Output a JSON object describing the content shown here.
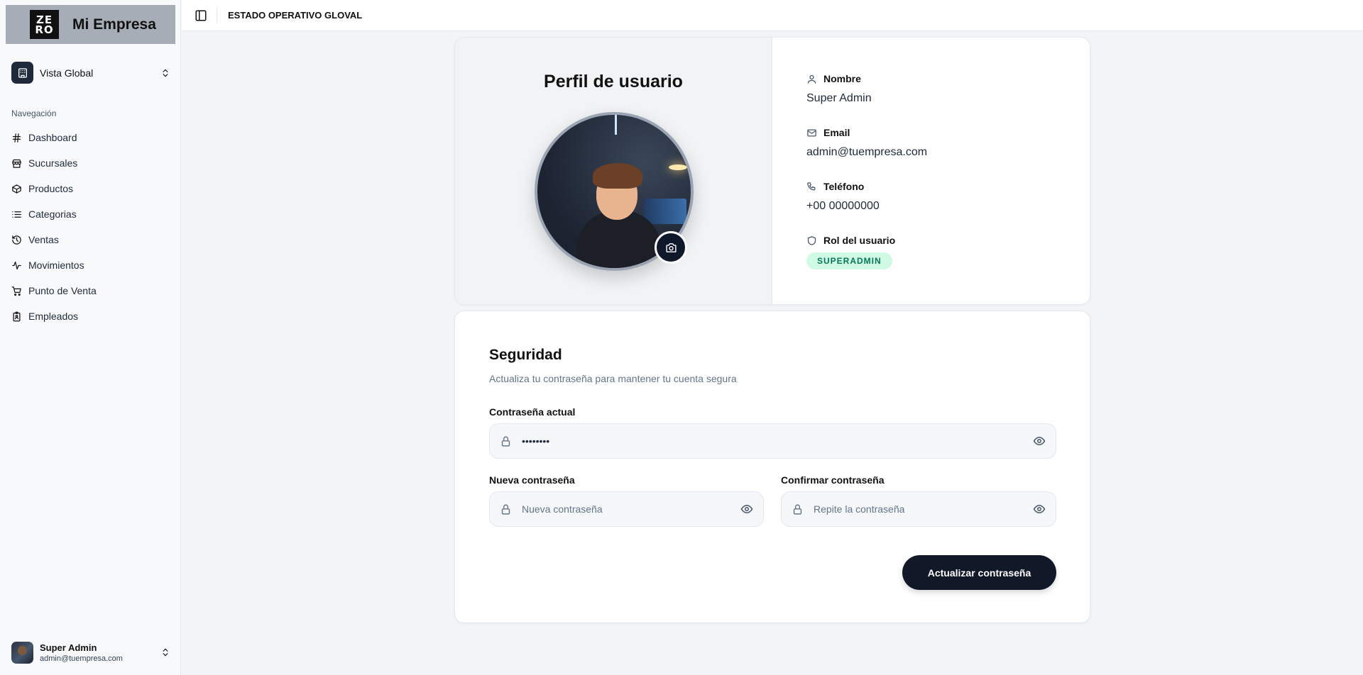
{
  "brand": {
    "logo_top": "ZE",
    "logo_bottom": "RO",
    "name": "Mi Empresa"
  },
  "workspace": {
    "label": "Vista Global"
  },
  "sidebar": {
    "section_title": "Navegación",
    "items": [
      {
        "label": "Dashboard",
        "icon": "hash-icon"
      },
      {
        "label": "Sucursales",
        "icon": "store-icon"
      },
      {
        "label": "Productos",
        "icon": "box-icon"
      },
      {
        "label": "Categorias",
        "icon": "list-icon"
      },
      {
        "label": "Ventas",
        "icon": "history-icon"
      },
      {
        "label": "Movimientos",
        "icon": "activity-icon"
      },
      {
        "label": "Punto de Venta",
        "icon": "cart-icon"
      },
      {
        "label": "Empleados",
        "icon": "badge-icon"
      }
    ]
  },
  "user_footer": {
    "name": "Super Admin",
    "email": "admin@tuempresa.com"
  },
  "header": {
    "title": "ESTADO OPERATIVO GLOVAL"
  },
  "profile": {
    "title": "Perfil de usuario",
    "name_label": "Nombre",
    "name_value": "Super Admin",
    "email_label": "Email",
    "email_value": "admin@tuempresa.com",
    "phone_label": "Teléfono",
    "phone_value": "+00 00000000",
    "role_label": "Rol del usuario",
    "role_value": "SUPERADMIN"
  },
  "security": {
    "title": "Seguridad",
    "subtitle": "Actualiza tu contraseña para mantener tu cuenta segura",
    "current_label": "Contraseña actual",
    "current_value": "••••••••",
    "new_label": "Nueva contraseña",
    "new_placeholder": "Nueva contraseña",
    "confirm_label": "Confirmar contraseña",
    "confirm_placeholder": "Repite la contraseña",
    "submit_label": "Actualizar contraseña"
  },
  "colors": {
    "accent_dark": "#111827",
    "badge_bg": "#d1fae5",
    "badge_text": "#047857"
  }
}
